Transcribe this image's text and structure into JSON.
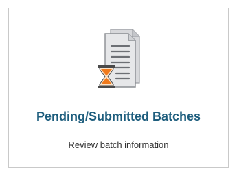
{
  "card": {
    "title": "Pending/Submitted Batches",
    "subtitle": "Review batch information",
    "icon": "pending-batches-icon"
  },
  "colors": {
    "title": "#1d5d7d",
    "document_fill": "#e4e5e7",
    "document_lines": "#8a8d92",
    "hourglass_frame": "#4a4a4a",
    "hourglass_sand": "#f07a1c",
    "card_border": "#c9c9c9"
  }
}
